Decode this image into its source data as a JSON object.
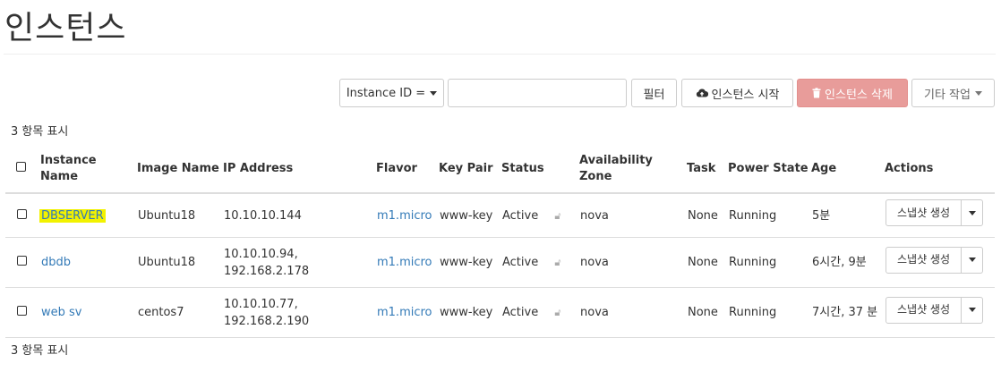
{
  "page": {
    "title": "인스턴스"
  },
  "toolbar": {
    "filter_select_label": "Instance ID =",
    "filter_input_value": "",
    "filter_button": "필터",
    "launch_button": "인스턴스 시작",
    "delete_button": "인스턴스 삭제",
    "more_actions_button": "기타 작업"
  },
  "summary": {
    "top_count": "3 항목 표시",
    "bottom_count": "3 항목 표시"
  },
  "table": {
    "headers": {
      "instance_name": "Instance Name",
      "image_name": "Image Name",
      "ip_address": "IP Address",
      "flavor": "Flavor",
      "key_pair": "Key Pair",
      "status": "Status",
      "availability_zone": "Availability Zone",
      "task": "Task",
      "power_state": "Power State",
      "age": "Age",
      "actions": "Actions"
    },
    "rows": [
      {
        "name": "DBSERVER",
        "image": "Ubuntu18",
        "ip_line1": "10.10.10.144",
        "ip_line2": "",
        "flavor": "m1.micro",
        "key_pair": "www-key",
        "status": "Active",
        "zone": "nova",
        "task": "None",
        "power": "Running",
        "age": "5분",
        "action": "스냅샷 생성"
      },
      {
        "name": "dbdb",
        "image": "Ubuntu18",
        "ip_line1": "10.10.10.94,",
        "ip_line2": "192.168.2.178",
        "flavor": "m1.micro",
        "key_pair": "www-key",
        "status": "Active",
        "zone": "nova",
        "task": "None",
        "power": "Running",
        "age": "6시간, 9분",
        "action": "스냅샷 생성"
      },
      {
        "name": "web sv",
        "image": "centos7",
        "ip_line1": "10.10.10.77,",
        "ip_line2": "192.168.2.190",
        "flavor": "m1.micro",
        "key_pair": "www-key",
        "status": "Active",
        "zone": "nova",
        "task": "None",
        "power": "Running",
        "age": "7시간, 37 분",
        "action": "스냅샷 생성"
      }
    ]
  },
  "colors": {
    "link": "#337ab7",
    "danger_button": "#e89c9a",
    "highlight": "#f2f200"
  }
}
